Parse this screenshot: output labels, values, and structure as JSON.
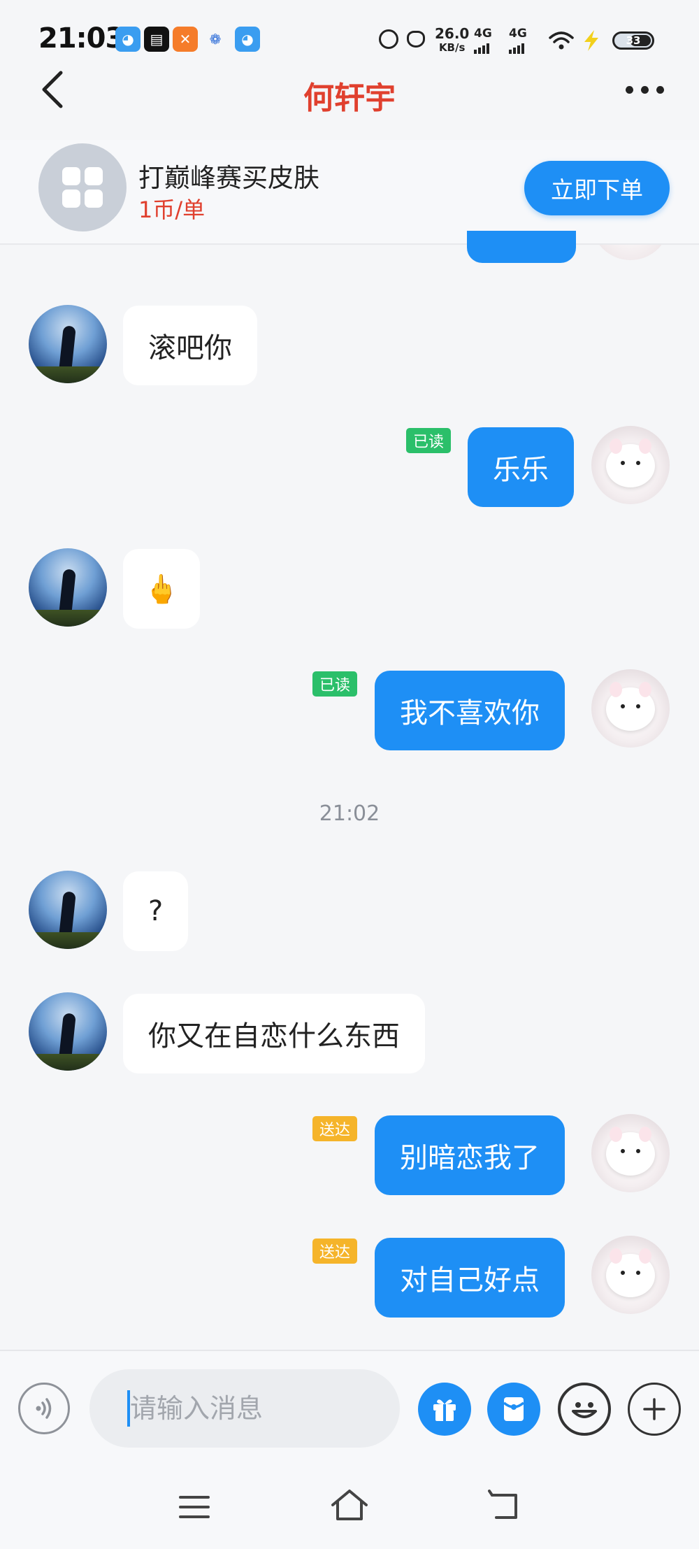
{
  "status_bar": {
    "time": "21:03",
    "net_speed_value": "26.0",
    "net_speed_unit": "KB/s",
    "signal1": "4G",
    "signal2": "4G",
    "battery": "33",
    "app_icons": [
      "pet-app-icon",
      "news-app-icon",
      "social-app-icon",
      "baidu-icon",
      "pet-app-icon-2"
    ]
  },
  "header": {
    "title": "何轩宇"
  },
  "product": {
    "name": "打巅峰赛买皮肤",
    "price": "1币/单",
    "order_button": "立即下单"
  },
  "messages": [
    {
      "from": "other",
      "text": "滚吧你"
    },
    {
      "from": "self",
      "text": "乐乐",
      "status": "已读"
    },
    {
      "from": "other",
      "text": "🖕"
    },
    {
      "from": "self",
      "text": "我不喜欢你",
      "status": "已读"
    },
    {
      "time_divider": "21:02"
    },
    {
      "from": "other",
      "text": "?"
    },
    {
      "from": "other",
      "text": "你又在自恋什么东西"
    },
    {
      "from": "self",
      "text": "别暗恋我了",
      "status": "送达"
    },
    {
      "from": "self",
      "text": "对自己好点",
      "status": "送达"
    }
  ],
  "input": {
    "placeholder": "请输入消息",
    "value": ""
  },
  "colors": {
    "accent": "#1e8ff5",
    "title": "#e0402e",
    "read_tag": "#2bbf6a",
    "sent_tag": "#f5b42a",
    "background": "#f5f6f8"
  }
}
